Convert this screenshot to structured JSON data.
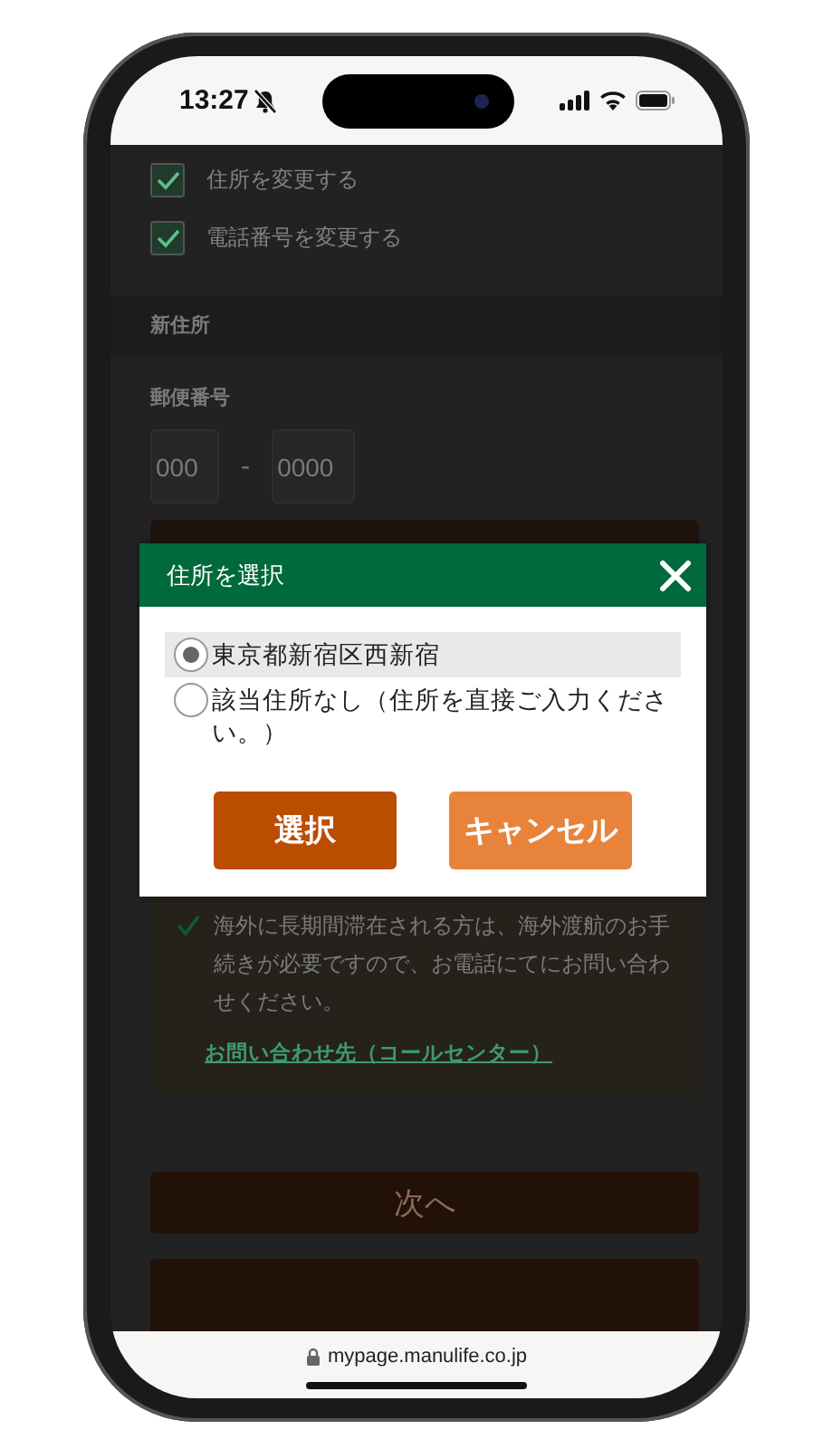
{
  "status_bar": {
    "time": "13:27"
  },
  "options": [
    {
      "label": "住所を変更する",
      "checked": true
    },
    {
      "label": "電話番号を変更する",
      "checked": true
    }
  ],
  "section": {
    "title": "新住所"
  },
  "postal": {
    "label": "郵便番号",
    "separator": "-",
    "fields": [
      {
        "placeholder": "000"
      },
      {
        "placeholder": "0000"
      }
    ]
  },
  "notice": {
    "text": "海外に長期間滞在される方は、海外渡航のお手続きが必要ですので、お電話にてにお問い合わせください。",
    "link": "お問い合わせ先（コールセンター）"
  },
  "next_button": {
    "label": "次へ"
  },
  "dialog": {
    "title": "住所を選択",
    "options": [
      {
        "label": "東京都新宿区西新宿",
        "selected": true
      },
      {
        "label": "該当住所なし（住所を直接ご入力ください。）",
        "selected": false
      }
    ],
    "buttons": [
      {
        "label": "選択",
        "kind": "primary"
      },
      {
        "label": "キャンセル",
        "kind": "secondary"
      }
    ]
  },
  "browser": {
    "url": "mypage.manulife.co.jp"
  }
}
